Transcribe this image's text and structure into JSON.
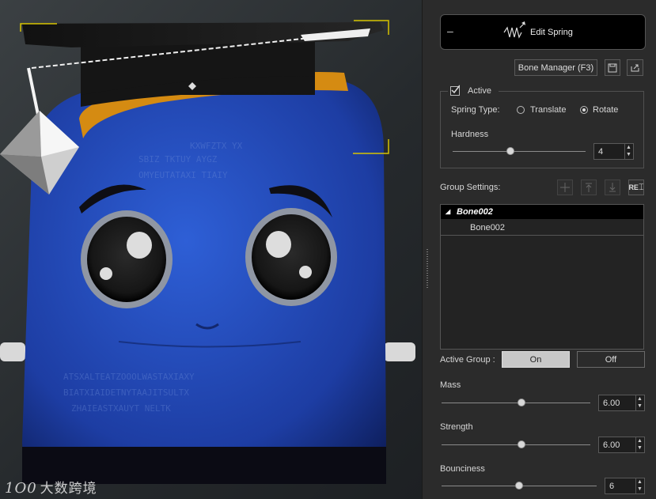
{
  "viewport": {
    "watermark_text": "大数跨境",
    "watermark_logo": "1O0"
  },
  "panel": {
    "header": {
      "title": "Edit Spring",
      "collapse_icon": "minus-icon",
      "spring_icon": "spring-icon"
    },
    "bone_manager_label": "Bone Manager (F3)",
    "active_label": "Active",
    "active_checked": true,
    "spring_type_label": "Spring Type:",
    "spring_types": [
      {
        "label": "Translate",
        "selected": false
      },
      {
        "label": "Rotate",
        "selected": true
      }
    ],
    "hardness": {
      "label": "Hardness",
      "value": "4"
    },
    "group_settings_label": "Group Settings:",
    "group_buttons": [
      "add-icon",
      "move-up-icon",
      "move-down-icon",
      "rename-icon"
    ],
    "rename_label": "RE",
    "tree": {
      "group_name": "Bone002",
      "bone_name": "Bone002"
    },
    "active_group": {
      "label": "Active Group :",
      "on_label": "On",
      "off_label": "Off",
      "selected": "On"
    },
    "mass": {
      "label": "Mass",
      "value": "6.00"
    },
    "strength": {
      "label": "Strength",
      "value": "6.00"
    },
    "bounciness": {
      "label": "Bounciness",
      "value": "6"
    }
  }
}
